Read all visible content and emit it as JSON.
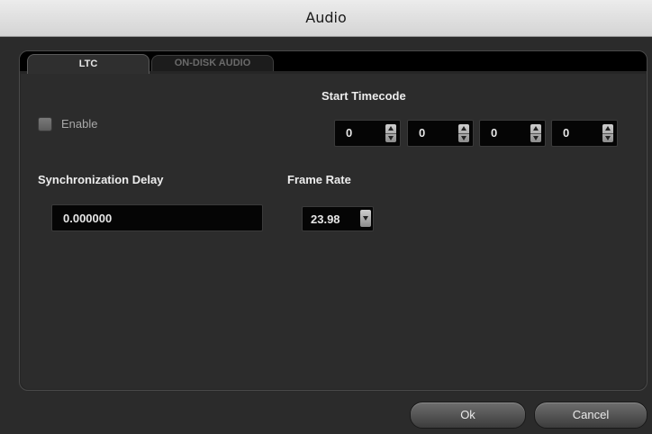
{
  "window": {
    "title": "Audio"
  },
  "tabs": [
    {
      "label": "LTC",
      "active": true
    },
    {
      "label": "ON-DISK AUDIO",
      "active": false
    }
  ],
  "ltc": {
    "enable": {
      "label": "Enable",
      "checked": false
    },
    "start_timecode": {
      "label": "Start Timecode",
      "fields": [
        "0",
        "0",
        "0",
        "0"
      ]
    },
    "sync_delay": {
      "label": "Synchronization Delay",
      "value": "0.000000"
    },
    "frame_rate": {
      "label": "Frame Rate",
      "value": "23.98"
    }
  },
  "buttons": {
    "ok": "Ok",
    "cancel": "Cancel"
  },
  "colors": {
    "background": "#2b2b2b",
    "field": "#050505",
    "titlebar": "#dcdcdc"
  }
}
